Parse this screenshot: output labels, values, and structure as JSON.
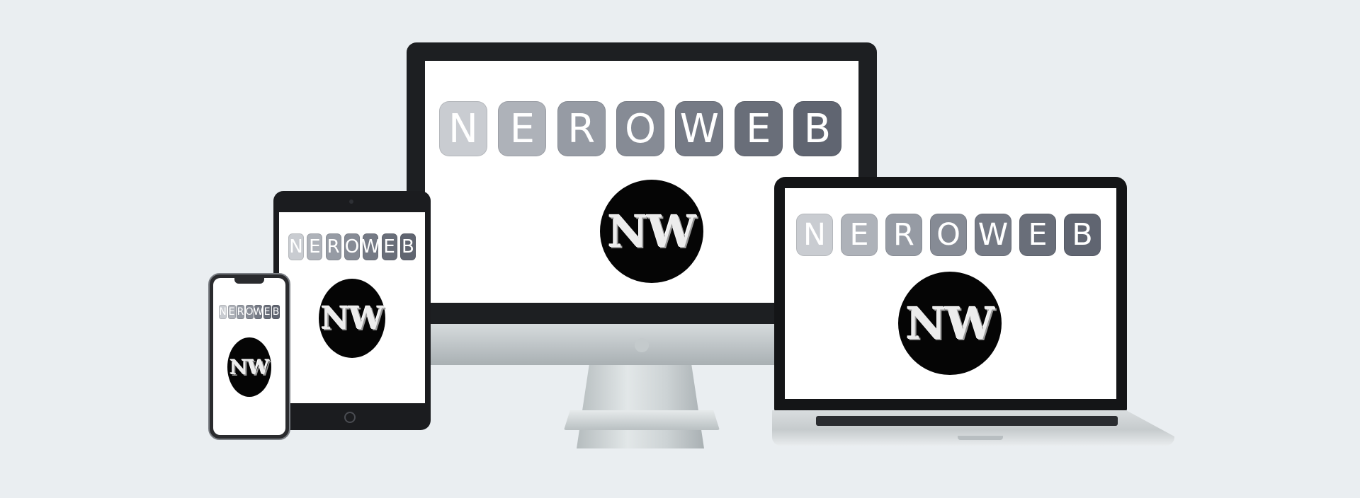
{
  "scene": {
    "background": "#eaeef1",
    "subject": "responsive-device-mockup"
  },
  "brand": {
    "wordmark_letters": [
      "N",
      "E",
      "R",
      "O",
      "W",
      "E",
      "B"
    ],
    "tile_colors": [
      "#c9ccd1",
      "#aeb2b9",
      "#969ba4",
      "#868b95",
      "#757a85",
      "#696e79",
      "#606571"
    ],
    "monogram": "NW",
    "badge_color": "#050505"
  },
  "devices": [
    "desktop-monitor",
    "laptop",
    "tablet",
    "phone"
  ]
}
